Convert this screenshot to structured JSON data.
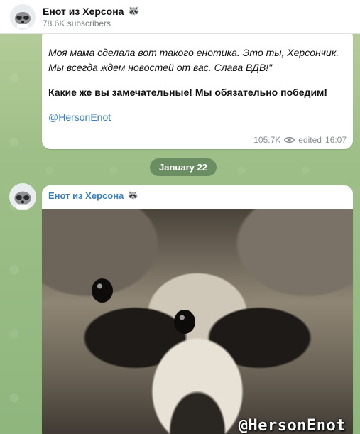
{
  "channel": {
    "name": "Енот из Херсона",
    "name_emoji": "🦝",
    "subscribers": "78.6K subscribers"
  },
  "message1": {
    "lines_italic": [
      "Моя мама сделала вот такого енотика. Это ты, Херсончик.",
      "Мы всегда ждем новостей от вас. Слава ВДВ!\""
    ],
    "bold_line": "Какие же вы замечательные! Мы обязательно победим!",
    "link": "@HersonEnot",
    "views": "105.7K",
    "edited_label": "edited",
    "time": "16:07"
  },
  "date_separator": "January 22",
  "message2": {
    "sender": "Енот из Херсона",
    "sender_emoji": "🦝",
    "photo_watermark": "@HersonEnot"
  },
  "colors": {
    "link": "#3a7fc2",
    "chat_background": "#a3c28b",
    "date_pill": "#587a54"
  }
}
